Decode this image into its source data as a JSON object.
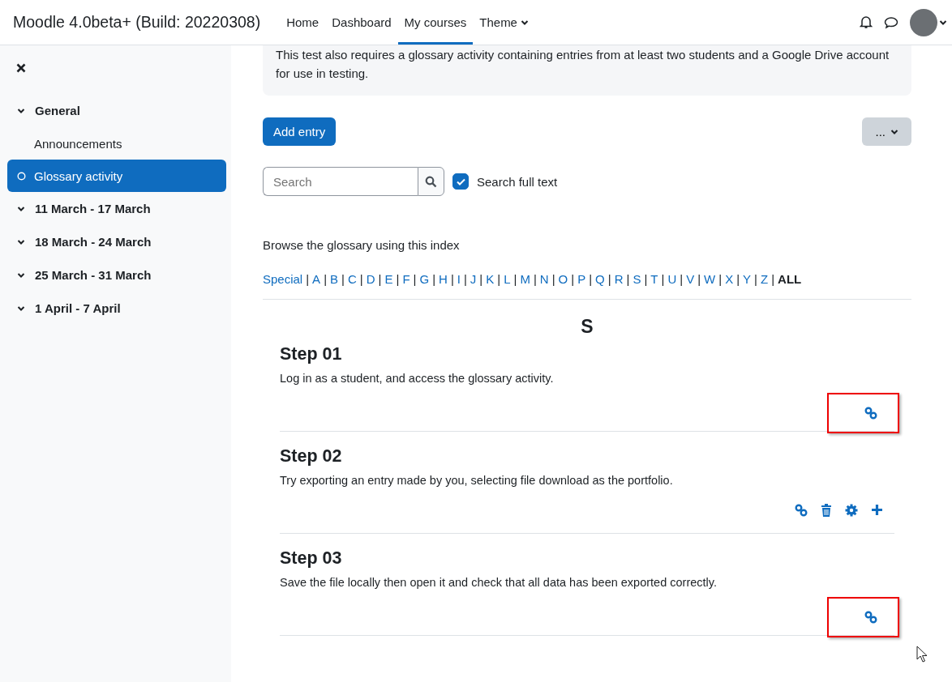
{
  "header": {
    "site_name": "Moodle 4.0beta+ (Build: 20220308)",
    "nav": [
      {
        "label": "Home",
        "selected": false,
        "dropdown": false
      },
      {
        "label": "Dashboard",
        "selected": false,
        "dropdown": false
      },
      {
        "label": "My courses",
        "selected": true,
        "dropdown": false
      },
      {
        "label": "Theme",
        "selected": false,
        "dropdown": true
      }
    ]
  },
  "sidebar": {
    "items": [
      {
        "label": "General",
        "expanded": true,
        "children": [
          {
            "label": "Announcements",
            "selected": false
          },
          {
            "label": "Glossary activity",
            "selected": true
          }
        ]
      },
      {
        "label": "11 March - 17 March",
        "expanded": true
      },
      {
        "label": "18 March - 24 March",
        "expanded": true
      },
      {
        "label": "25 March - 31 March",
        "expanded": true
      },
      {
        "label": "1 April - 7 April",
        "expanded": true
      }
    ]
  },
  "main": {
    "info_text": "This test also requires a glossary activity containing entries from at least two students and a Google Drive account for use in testing.",
    "add_entry_button": "Add entry",
    "more_menu": "...",
    "search": {
      "placeholder": "Search"
    },
    "search_full_text": {
      "label": "Search full text",
      "checked": true
    },
    "browse_label": "Browse the glossary using this index",
    "index": [
      {
        "label": "Special",
        "selected": false
      },
      {
        "separator": "|",
        "label": "A",
        "selected": false
      },
      {
        "separator": "|",
        "label": "B",
        "selected": false
      },
      {
        "separator": "|",
        "label": "C",
        "selected": false
      },
      {
        "separator": "|",
        "label": "D",
        "selected": false
      },
      {
        "separator": "|",
        "label": "E",
        "selected": false
      },
      {
        "separator": "|",
        "label": "F",
        "selected": false
      },
      {
        "separator": "|",
        "label": "G",
        "selected": false
      },
      {
        "separator": "|",
        "label": "H",
        "selected": false
      },
      {
        "separator": "|",
        "label": "I",
        "selected": false
      },
      {
        "separator": "|",
        "label": "J",
        "selected": false
      },
      {
        "separator": "|",
        "label": "K",
        "selected": false
      },
      {
        "separator": "|",
        "label": "L",
        "selected": false
      },
      {
        "separator": "|",
        "label": "M",
        "selected": false
      },
      {
        "separator": "|",
        "label": "N",
        "selected": false
      },
      {
        "separator": "|",
        "label": "O",
        "selected": false
      },
      {
        "separator": "|",
        "label": "P",
        "selected": false
      },
      {
        "separator": "|",
        "label": "Q",
        "selected": false
      },
      {
        "separator": "|",
        "label": "R",
        "selected": false
      },
      {
        "separator": "|",
        "label": "S",
        "selected": false
      },
      {
        "separator": "|",
        "label": "T",
        "selected": false
      },
      {
        "separator": "|",
        "label": "U",
        "selected": false
      },
      {
        "separator": "|",
        "label": "V",
        "selected": false
      },
      {
        "separator": "|",
        "label": "W",
        "selected": false
      },
      {
        "separator": "|",
        "label": "X",
        "selected": false
      },
      {
        "separator": "|",
        "label": "Y",
        "selected": false
      },
      {
        "separator": "|",
        "label": "Z",
        "selected": false
      },
      {
        "separator": "|",
        "label": "ALL",
        "selected": true
      }
    ],
    "letter_heading": "S",
    "entries": [
      {
        "title": "Step 01",
        "text": "Log in as a student, and access the glossary activity.",
        "highlighted": true,
        "actions": [
          {
            "kind": "link"
          }
        ]
      },
      {
        "title": "Step 02",
        "text": "Try exporting an entry made by you, selecting file download as the portfolio.",
        "highlighted": false,
        "actions": [
          {
            "kind": "link"
          },
          {
            "kind": "delete"
          },
          {
            "kind": "settings"
          },
          {
            "kind": "add"
          }
        ]
      },
      {
        "title": "Step 03",
        "text": "Save the file locally then open it and check that all data has been exported correctly.",
        "highlighted": true,
        "actions": [
          {
            "kind": "link"
          }
        ]
      }
    ]
  }
}
